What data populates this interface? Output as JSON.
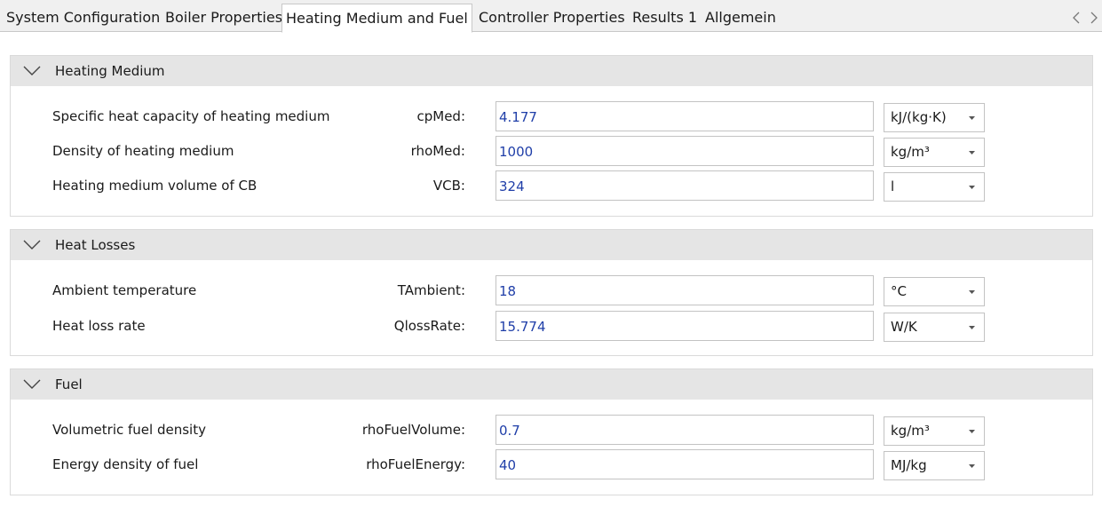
{
  "tabs": [
    {
      "label": "System Configuration"
    },
    {
      "label": "Boiler Properties"
    },
    {
      "label": "Heating Medium and Fuel"
    },
    {
      "label": "Controller Properties"
    },
    {
      "label": "Results 1"
    },
    {
      "label": "Allgemein"
    }
  ],
  "active_tab": "Heating Medium and Fuel",
  "sections": [
    {
      "title": "Heating Medium",
      "rows": [
        {
          "label": "Specific heat capacity of heating medium",
          "var": "cpMed:",
          "value": "4.177",
          "unit": "kJ/(kg·K)"
        },
        {
          "label": "Density of heating medium",
          "var": "rhoMed:",
          "value": "1000",
          "unit": "kg/m³"
        },
        {
          "label": "Heating medium volume of CB",
          "var": "VCB:",
          "value": "324",
          "unit": "l"
        }
      ]
    },
    {
      "title": "Heat Losses",
      "rows": [
        {
          "label": "Ambient temperature",
          "var": "TAmbient:",
          "value": "18",
          "unit": "°C"
        },
        {
          "label": "Heat loss rate",
          "var": "QlossRate:",
          "value": "15.774",
          "unit": "W/K"
        }
      ]
    },
    {
      "title": "Fuel",
      "rows": [
        {
          "label": "Volumetric fuel density",
          "var": "rhoFuelVolume:",
          "value": "0.7",
          "unit": "kg/m³"
        },
        {
          "label": "Energy density of fuel",
          "var": "rhoFuelEnergy:",
          "value": "40",
          "unit": "MJ/kg"
        }
      ]
    }
  ],
  "colors": {
    "value_text": "#1f3ea8",
    "section_header_bg": "#e5e5e5",
    "tabbar_bg": "#f0f0f0"
  },
  "icons": {
    "tab_prev": "chevron-left-icon",
    "tab_next": "chevron-right-icon",
    "section_toggle": "chevron-down-icon",
    "unit_dropdown": "caret-down-icon"
  }
}
